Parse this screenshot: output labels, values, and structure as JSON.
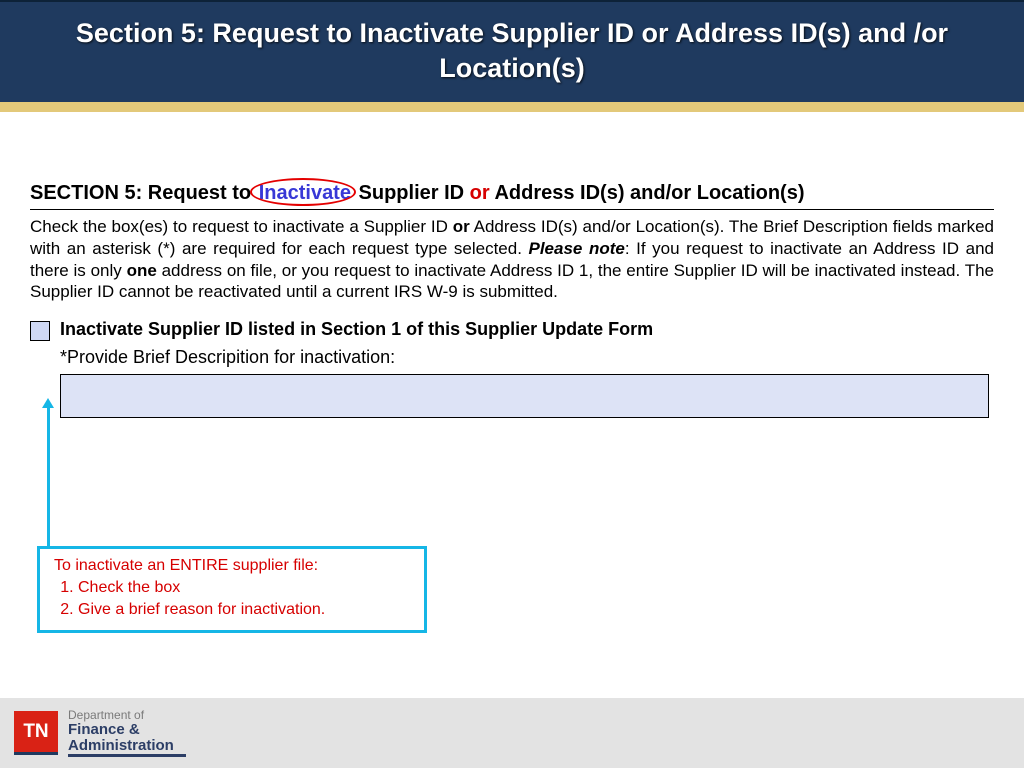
{
  "header": {
    "title": "Section 5:  Request to Inactivate Supplier ID or Address ID(s) and /or Location(s)"
  },
  "form": {
    "section_title_prefix": "SECTION 5: Request to ",
    "section_title_circled": "Inactivate",
    "section_title_mid": " Supplier ID ",
    "section_title_or": "or",
    "section_title_suffix": " Address ID(s) and/or Location(s)",
    "instructions_1": "Check the box(es) to request to inactivate a Supplier ID ",
    "instructions_or1": "or",
    "instructions_2": " Address ID(s) and/or Location(s). The Brief Description fields marked with an asterisk (*) are required for each request type selected. ",
    "instructions_please_note": "Please note",
    "instructions_3": ": If you request to inactivate an Address ID and there is only ",
    "instructions_one": "one",
    "instructions_4": " address on file, or you request to inactivate Address ID 1, the entire Supplier ID will be inactivated instead. The Supplier ID cannot be reactivated until a current IRS W-9 is submitted.",
    "checkbox_label": "Inactivate Supplier ID listed in Section 1 of this Supplier Update Form",
    "desc_label": "*Provide Brief Descripition for inactivation:"
  },
  "callout": {
    "title": "To inactivate an ENTIRE supplier file:",
    "items": [
      "Check the box",
      "Give a brief reason for inactivation."
    ]
  },
  "footer": {
    "logo_text": "TN",
    "dept_of": "Department of",
    "dept_line1": "Finance &",
    "dept_line2": "Administration"
  }
}
